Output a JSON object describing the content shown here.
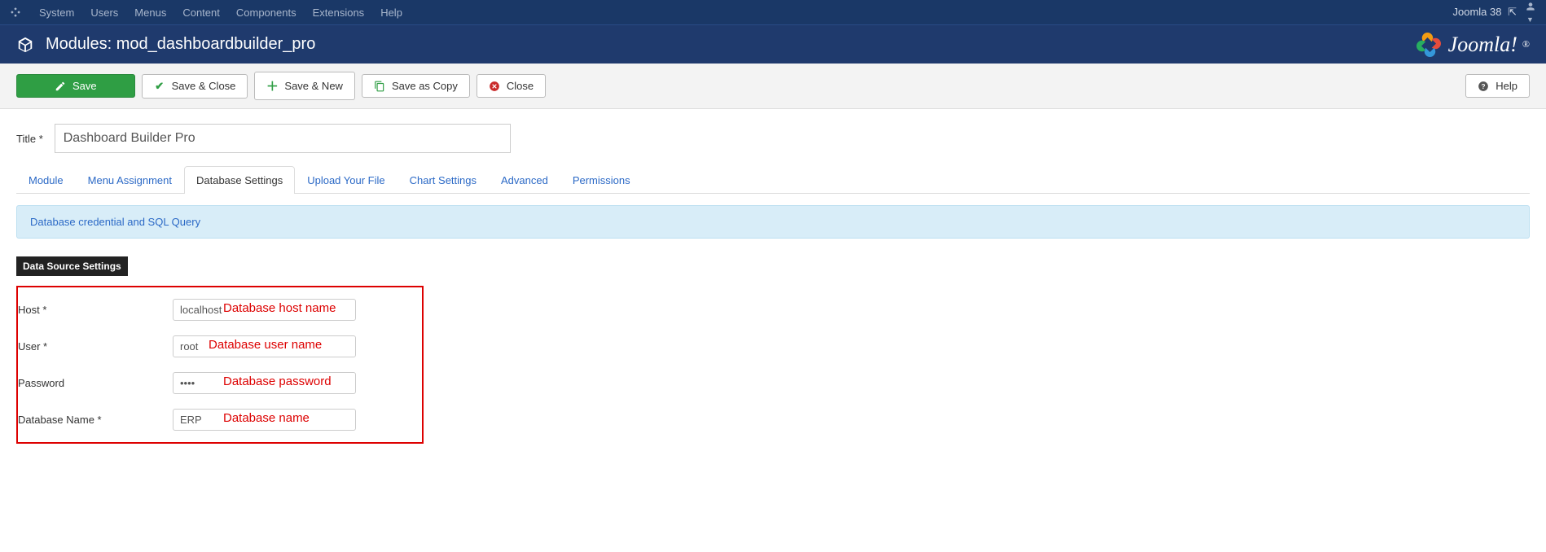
{
  "topnav": {
    "menu": [
      "System",
      "Users",
      "Menus",
      "Content",
      "Components",
      "Extensions",
      "Help"
    ],
    "sitename": "Joomla 38"
  },
  "titlebar": {
    "title": "Modules: mod_dashboardbuilder_pro",
    "brand": "Joomla!"
  },
  "toolbar": {
    "save": "Save",
    "save_close": "Save & Close",
    "save_new": "Save & New",
    "save_copy": "Save as Copy",
    "close": "Close",
    "help": "Help"
  },
  "form": {
    "title_label": "Title *",
    "title_value": "Dashboard Builder Pro"
  },
  "tabs": [
    "Module",
    "Menu Assignment",
    "Database Settings",
    "Upload Your File",
    "Chart Settings",
    "Advanced",
    "Permissions"
  ],
  "active_tab": 2,
  "infobox": "Database credential and SQL Query",
  "section_header": "Data Source Settings",
  "fields": {
    "host": {
      "label": "Host *",
      "value": "localhost",
      "annot": "Database host name"
    },
    "user": {
      "label": "User *",
      "value": "root",
      "annot": "Database user name"
    },
    "password": {
      "label": "Password",
      "value": "••••",
      "annot": "Database password"
    },
    "dbname": {
      "label": "Database Name *",
      "value": "ERP",
      "annot": "Database name"
    }
  }
}
